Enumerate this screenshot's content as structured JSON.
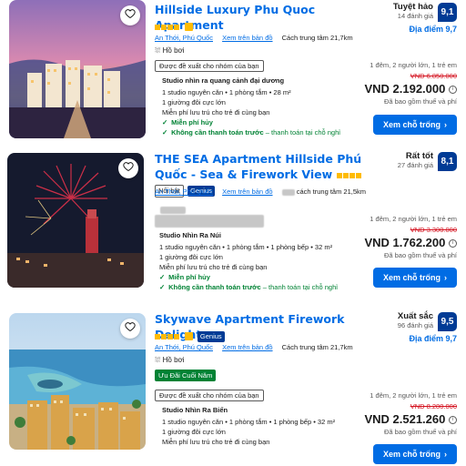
{
  "listings": [
    {
      "title": "Hillside Luxury Phu Quoc Apartment",
      "star_count": 4,
      "area": "An Thới, Phú Quốc",
      "map_link": "Xem trên bản đồ",
      "distance": "Cách trung tâm 21,7km",
      "feature_tag": "Hồ bơi",
      "review_word": "Tuyệt hảo",
      "review_count": "14 đánh giá",
      "score": "9,1",
      "location_score": "Địa điểm 9,7",
      "recommend": "Được đề xuất cho nhóm của bạn",
      "room_name": "Studio nhìn ra quang cảnh đại dương",
      "room_lines": [
        "1 studio nguyên căn • 1 phòng tắm • 28 m²",
        "1 giường đôi cực lớn",
        "Miễn phí lưu trú cho trẻ đi cùng bạn"
      ],
      "perk1": "Miễn phí hủy",
      "perk2": "Không cần thanh toán trước",
      "perk2_sub": " – thanh toán tại chỗ nghỉ",
      "stay_meta": "1 đêm, 2 người lớn, 1 trẻ em",
      "old_price": "VND 6.850.000",
      "price": "VND 2.192.000",
      "tax_note": "Đã bao gồm thuế và phí",
      "cta": "Xem chỗ trống"
    },
    {
      "title": "THE SEA Apartment Hillside Phú Quốc - Sea & Firework View",
      "star_count": 4,
      "badge_featured": "Nổi bật",
      "badge_genius": "Genius",
      "area": "An Thới, Phú Quốc",
      "map_link": "Xem trên bản đồ",
      "distance": "cách trung tâm 21,5km",
      "review_word": "Rất tốt",
      "review_count": "27 đánh giá",
      "score": "8,1",
      "room_name": "Studio Nhìn Ra Núi",
      "room_lines": [
        "1 studio nguyên căn • 1 phòng tắm • 1 phòng bếp • 32 m²",
        "1 giường đôi cực lớn",
        "Miễn phí lưu trú cho trẻ đi cùng bạn"
      ],
      "perk1": "Miễn phí hủy",
      "perk2": "Không cần thanh toán trước",
      "perk2_sub": " – thanh toán tại chỗ nghỉ",
      "stay_meta": "1 đêm, 2 người lớn, 1 trẻ em",
      "old_price": "VND 3.300.000",
      "price": "VND 1.762.200",
      "tax_note": "Đã bao gồm thuế và phí",
      "cta": "Xem chỗ trống"
    },
    {
      "title": "Skywave Apartment Firework Delight",
      "star_count": 4,
      "badge_genius": "Genius",
      "area": "An Thới, Phú Quốc",
      "map_link": "Xem trên bản đồ",
      "distance": "Cách trung tâm 21,7km",
      "feature_tag": "Hồ bơi",
      "deal": "Ưu Đãi Cuối Năm",
      "review_word": "Xuất sắc",
      "review_count": "96 đánh giá",
      "score": "9,5",
      "location_score": "Địa điểm 9,7",
      "recommend": "Được đề xuất cho nhóm của bạn",
      "room_name": "Studio Nhìn Ra Biển",
      "room_lines": [
        "1 studio nguyên căn • 1 phòng tắm • 1 phòng bếp • 32 m²",
        "1 giường đôi cực lớn",
        "Miễn phí lưu trú cho trẻ đi cùng bạn"
      ],
      "stay_meta": "1 đêm, 2 người lớn, 1 trẻ em",
      "old_price": "VND 8.280.000",
      "price": "VND 2.521.260",
      "tax_note": "Đã bao gồm thuế và phí",
      "cta": "Xem chỗ trống"
    }
  ],
  "icons": {
    "heart": "heart-icon",
    "pool": "pool-icon",
    "chevron": "chevron-right-icon",
    "info": "info-icon",
    "check": "check-icon"
  },
  "colors": {
    "link": "#006ce4",
    "score_bg": "#003b95",
    "star": "#febb02",
    "green": "#008234",
    "red": "#d4111e"
  }
}
